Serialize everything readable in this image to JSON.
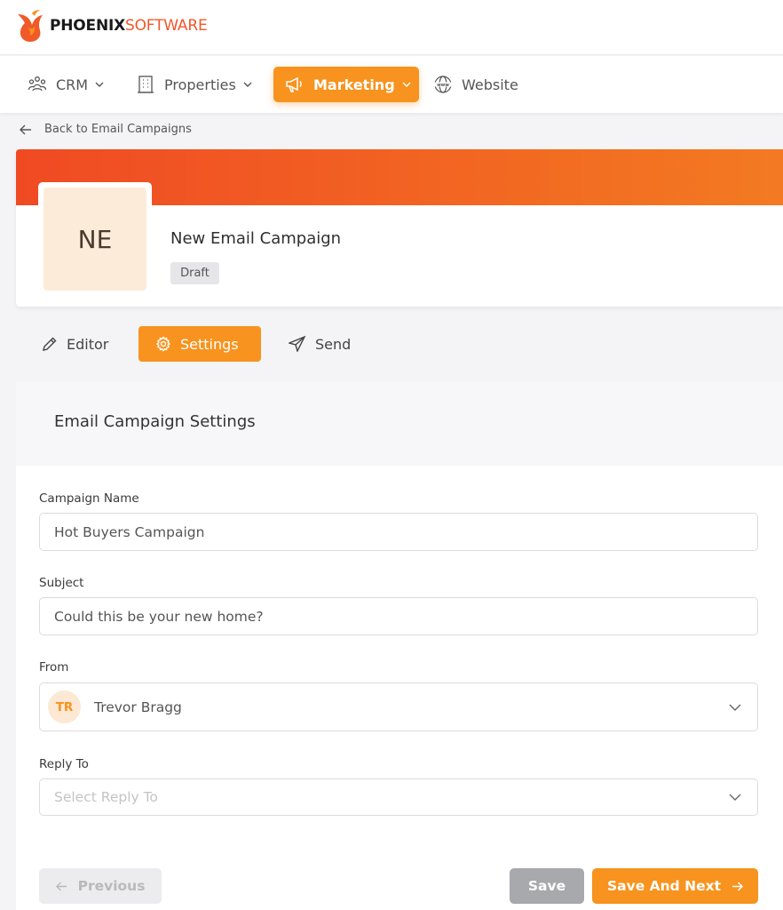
{
  "brand": {
    "bold": "PHOENIX",
    "light": "SOFTWARE",
    "logo_icon": "phoenix-flame-icon",
    "accent": "#f7931e"
  },
  "nav": {
    "items": [
      {
        "label": "CRM",
        "icon": "people-icon",
        "dropdown": true
      },
      {
        "label": "Properties",
        "icon": "building-icon",
        "dropdown": true
      },
      {
        "label": "Marketing",
        "icon": "megaphone-icon",
        "dropdown": true,
        "active": true
      },
      {
        "label": "Website",
        "icon": "www-globe-icon",
        "dropdown": false
      }
    ]
  },
  "back_link": "Back to Email Campaigns",
  "campaign": {
    "initials": "NE",
    "title": "New Email Campaign",
    "status": "Draft"
  },
  "tabs": [
    {
      "label": "Editor",
      "icon": "pencil-icon"
    },
    {
      "label": "Settings",
      "icon": "gear-icon",
      "active": true
    },
    {
      "label": "Send",
      "icon": "send-icon"
    }
  ],
  "settings": {
    "title": "Email Campaign Settings",
    "campaign_name": {
      "label": "Campaign Name",
      "value": "Hot Buyers Campaign"
    },
    "subject": {
      "label": "Subject",
      "value": "Could this be your new home?"
    },
    "from": {
      "label": "From",
      "initials": "TR",
      "value": "Trevor Bragg"
    },
    "reply_to": {
      "label": "Reply To",
      "placeholder": "Select Reply To"
    }
  },
  "buttons": {
    "previous": "Previous",
    "save": "Save",
    "save_next": "Save And Next"
  }
}
